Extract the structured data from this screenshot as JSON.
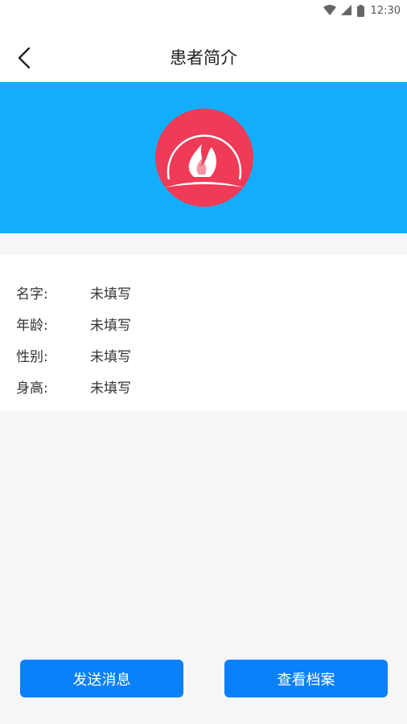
{
  "status_bar": {
    "time": "12:30"
  },
  "header": {
    "title": "患者简介"
  },
  "profile": {
    "banner_color": "#12aefc",
    "logo_color": "#ef3b57",
    "fields": [
      {
        "label": "名字:",
        "value": "未填写"
      },
      {
        "label": "年龄:",
        "value": "未填写"
      },
      {
        "label": "性别:",
        "value": "未填写"
      },
      {
        "label": "身高:",
        "value": "未填写"
      }
    ]
  },
  "actions": {
    "send_message": "发送消息",
    "view_records": "查看档案",
    "button_color": "#0a80fb"
  }
}
